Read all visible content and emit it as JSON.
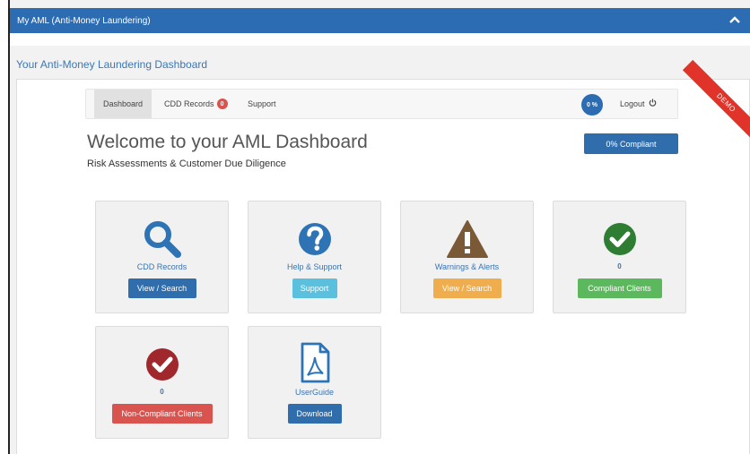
{
  "header": {
    "title": "My AML (Anti-Money Laundering)",
    "collapse_icon": "chevron-up-icon"
  },
  "page_title": "Your Anti-Money Laundering Dashboard",
  "nav": {
    "dashboard": "Dashboard",
    "cdd_records": "CDD Records",
    "cdd_badge": "0",
    "support": "Support",
    "percent": "0 %",
    "logout": "Logout",
    "logout_icon": "power-icon"
  },
  "ribbon": "DEMO",
  "welcome": {
    "title": "Welcome to your AML Dashboard",
    "subtitle": "Risk Assessments & Customer Due Diligence",
    "compliant_button": "0% Compliant"
  },
  "tiles": [
    {
      "icon": "search-icon",
      "label": "CDD Records",
      "button": "View / Search",
      "color": "#2f6dad"
    },
    {
      "icon": "question-circle-icon",
      "label": "Help & Support",
      "button": "Support",
      "color": "#5bc0de"
    },
    {
      "icon": "warning-triangle-icon",
      "label": "Warnings & Alerts",
      "button": "View / Search",
      "color": "#f0ad4e"
    },
    {
      "icon": "check-circle-icon",
      "count": "0",
      "button": "Compliant Clients",
      "color": "#5cb85c"
    },
    {
      "icon": "check-circle-red-icon",
      "count": "0",
      "button": "Non-Compliant Clients",
      "color": "#d9534f"
    },
    {
      "icon": "pdf-file-icon",
      "label": "UserGuide",
      "button": "Download",
      "color": "#2f6dad"
    }
  ],
  "colors": {
    "brand_blue": "#2b6cb3",
    "icon_blue": "#2e74b5",
    "icon_brown": "#7a5a36",
    "icon_green": "#2e7d32",
    "icon_red": "#a0282c",
    "ribbon_red": "#e0342a"
  }
}
